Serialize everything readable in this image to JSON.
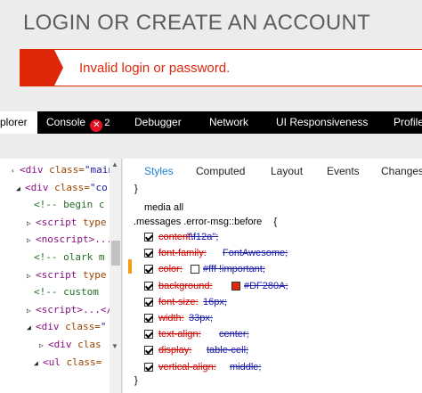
{
  "page": {
    "title": "LOGIN OR CREATE AN ACCOUNT",
    "error_message": "Invalid login or password."
  },
  "devtools": {
    "tabs": [
      {
        "label": "plorer"
      },
      {
        "label": "Console"
      },
      {
        "label": "Debugger"
      },
      {
        "label": "Network"
      },
      {
        "label": "UI Responsiveness"
      },
      {
        "label": "Profile"
      }
    ],
    "console_error_count": "2",
    "dom_lines": [
      {
        "t": "‹",
        "k": "div",
        "attr": "class=",
        "val": "\"main\""
      },
      {
        "t": "◢",
        "k": "div",
        "attr": "class=",
        "val": "\"co"
      },
      {
        "t": "",
        "cmt": "<!-- begin c"
      },
      {
        "t": "▷",
        "k": "script",
        "attr": "type",
        "val": ""
      },
      {
        "t": "▷",
        "k": "noscript",
        "attr": "",
        "val": "...<"
      },
      {
        "t": "",
        "cmt": "<!-- olark m"
      },
      {
        "t": "▷",
        "k": "script",
        "attr": "type",
        "val": ""
      },
      {
        "t": "",
        "cmt": "<!-- custom"
      },
      {
        "t": "▷",
        "k": "script",
        "attr": "",
        "val": "...</s"
      },
      {
        "t": "◢",
        "k": "div",
        "attr": "class=",
        "val": "\""
      },
      {
        "t": "▷",
        "k": "div",
        "attr": "clas",
        "val": ""
      },
      {
        "t": "◢",
        "k": "ul",
        "attr": "class=",
        "val": ""
      }
    ],
    "subtabs": [
      "Styles",
      "Computed",
      "Layout",
      "Events",
      "Changes"
    ],
    "brace_close": "}",
    "media_label": "media all",
    "selector": ".messages .error-msg::before",
    "selector_brace": "{",
    "rule_close": "}",
    "properties": [
      {
        "name": "content:",
        "value": "\"\\f12a\";"
      },
      {
        "name": "font-family:",
        "value": "FontAwesome;"
      },
      {
        "name": "color:",
        "value": "#fff !important;",
        "swatch": "#ffffff"
      },
      {
        "name": "background:",
        "value": "#DF280A;",
        "swatch": "#df280a"
      },
      {
        "name": "font-size:",
        "value": "16px;"
      },
      {
        "name": "width:",
        "value": "33px;"
      },
      {
        "name": "text-align:",
        "value": "center;"
      },
      {
        "name": "display:",
        "value": "table-cell;"
      },
      {
        "name": "vertical-align:",
        "value": "middle;"
      }
    ]
  },
  "colors": {
    "error_accent": "#df280a",
    "active_subtab": "#1b7fd3",
    "changed_marker": "#f39c12"
  }
}
